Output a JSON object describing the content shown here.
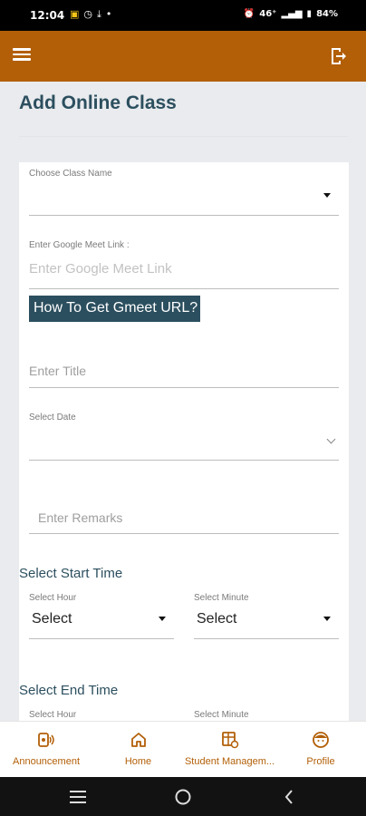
{
  "status_bar": {
    "time": "12:04",
    "network": "46⁺",
    "battery": "84%"
  },
  "app_bar": {
    "menu_icon": "hamburger-menu-icon",
    "logout_icon": "logout-icon",
    "color": "#b25f07"
  },
  "page": {
    "title": "Add Online Class"
  },
  "form": {
    "class_name": {
      "label": "Choose Class Name",
      "value": ""
    },
    "meet_link": {
      "label": "Enter Google Meet Link :",
      "placeholder": "Enter Google Meet Link"
    },
    "gmeet_help_link": "How To Get Gmeet URL?",
    "title": {
      "placeholder": "Enter Title"
    },
    "date": {
      "label": "Select Date",
      "value": ""
    },
    "remarks": {
      "placeholder": "Enter Remarks"
    },
    "start_time": {
      "heading": "Select Start Time",
      "hour_label": "Select Hour",
      "hour_value": "Select",
      "minute_label": "Select Minute",
      "minute_value": "Select"
    },
    "end_time": {
      "heading": "Select End Time",
      "hour_label": "Select Hour",
      "minute_label": "Select Minute"
    }
  },
  "bottom_nav": {
    "items": [
      {
        "label": "Announcement",
        "icon": "announcement-icon"
      },
      {
        "label": "Home",
        "icon": "home-icon"
      },
      {
        "label": "Student Managem...",
        "icon": "student-management-icon"
      },
      {
        "label": "Profile",
        "icon": "profile-icon"
      }
    ]
  },
  "colors": {
    "accent": "#b25f07",
    "heading": "#2c4f5f"
  }
}
